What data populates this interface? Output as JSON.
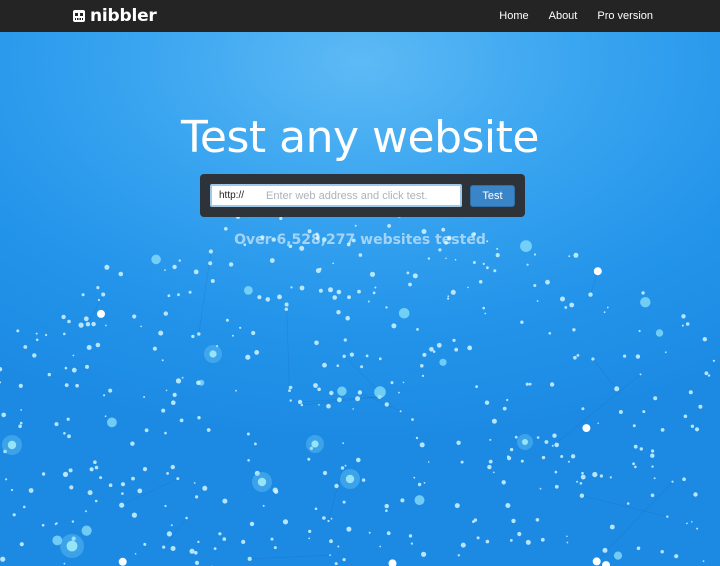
{
  "brand": {
    "name": "nibbler",
    "logo_icon": "robot-face-icon"
  },
  "nav": {
    "links": [
      {
        "label": "Home"
      },
      {
        "label": "About"
      },
      {
        "label": "Pro version"
      }
    ]
  },
  "hero": {
    "headline": "Test any website",
    "search": {
      "prefix": "http://",
      "placeholder": "Enter web address and click test.",
      "value": "",
      "button_label": "Test"
    },
    "stat_text": "Over 6,528,277 websites tested"
  },
  "colors": {
    "navbar_bg": "#242424",
    "hero_blue": "#2394ea",
    "button_blue": "#3a85c8",
    "search_panel": "#2d3338"
  }
}
